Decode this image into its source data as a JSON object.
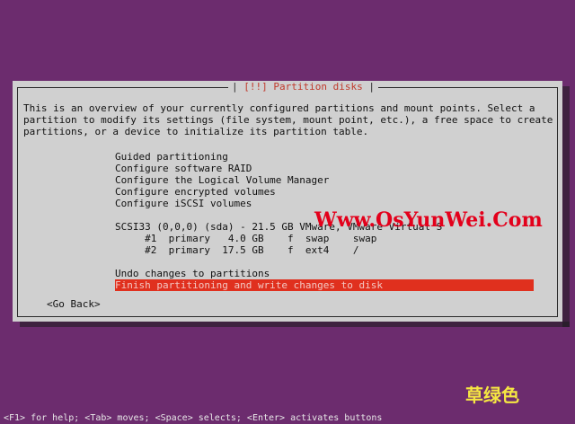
{
  "dialog": {
    "title_left": "[!!]",
    "title_text": "Partition disks",
    "intro_lines": [
      "This is an overview of your currently configured partitions and mount points. Select a",
      "partition to modify its settings (file system, mount point, etc.), a free space to create",
      "partitions, or a device to initialize its partition table."
    ],
    "menu": {
      "options": [
        "Guided partitioning",
        "Configure software RAID",
        "Configure the Logical Volume Manager",
        "Configure encrypted volumes",
        "Configure iSCSI volumes"
      ],
      "disk": "SCSI33 (0,0,0) (sda) - 21.5 GB VMware, VMware Virtual S",
      "partitions": [
        "     #1  primary   4.0 GB    f  swap    swap",
        "     #2  primary  17.5 GB    f  ext4    /"
      ],
      "undo": "Undo changes to partitions",
      "finish": "Finish partitioning and write changes to disk"
    },
    "go_back": "<Go Back>"
  },
  "watermark": "Www.OsYunWei.Com",
  "stamp": "草绿色",
  "footer": "<F1> for help; <Tab> moves; <Space> selects; <Enter> activates buttons",
  "colors": {
    "background": "#6c2c6e",
    "dialog": "#d0d0d0",
    "selected": "#e0301e",
    "title": "#c0392b"
  }
}
